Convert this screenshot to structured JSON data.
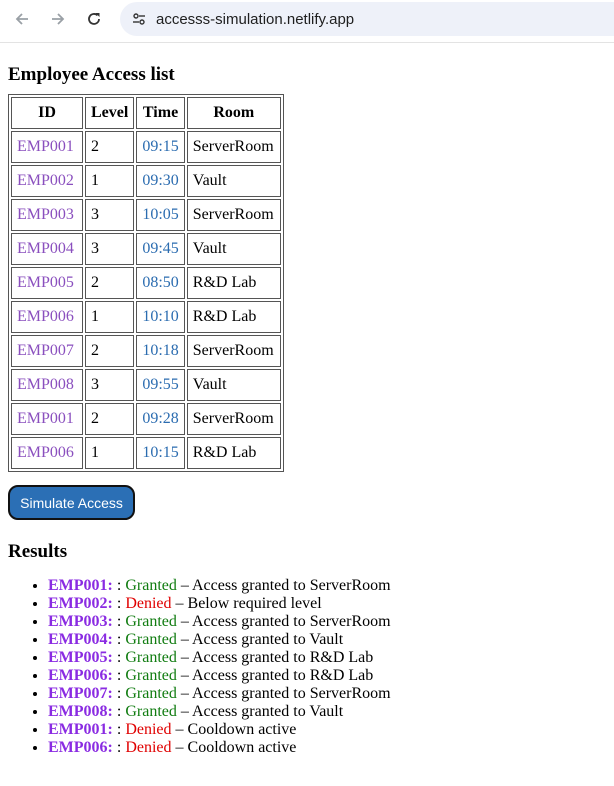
{
  "browser": {
    "url": "accesss-simulation.netlify.app"
  },
  "page": {
    "heading": "Employee Access list",
    "columns": [
      "ID",
      "Level",
      "Time",
      "Room"
    ],
    "rows": [
      {
        "id": "EMP001",
        "level": "2",
        "time": "09:15",
        "room": "ServerRoom"
      },
      {
        "id": "EMP002",
        "level": "1",
        "time": "09:30",
        "room": "Vault"
      },
      {
        "id": "EMP003",
        "level": "3",
        "time": "10:05",
        "room": "ServerRoom"
      },
      {
        "id": "EMP004",
        "level": "3",
        "time": "09:45",
        "room": "Vault"
      },
      {
        "id": "EMP005",
        "level": "2",
        "time": "08:50",
        "room": "R&D Lab"
      },
      {
        "id": "EMP006",
        "level": "1",
        "time": "10:10",
        "room": "R&D Lab"
      },
      {
        "id": "EMP007",
        "level": "2",
        "time": "10:18",
        "room": "ServerRoom"
      },
      {
        "id": "EMP008",
        "level": "3",
        "time": "09:55",
        "room": "Vault"
      },
      {
        "id": "EMP001",
        "level": "2",
        "time": "09:28",
        "room": "ServerRoom"
      },
      {
        "id": "EMP006",
        "level": "1",
        "time": "10:15",
        "room": "R&D Lab"
      }
    ],
    "button_label": "Simulate Access",
    "results_heading": "Results",
    "results": [
      {
        "id": "EMP001:",
        "sep": " : ",
        "status": "Granted",
        "message": " – Access granted to ServerRoom"
      },
      {
        "id": "EMP002:",
        "sep": " : ",
        "status": "Denied",
        "message": " – Below required level"
      },
      {
        "id": "EMP003:",
        "sep": " : ",
        "status": "Granted",
        "message": " – Access granted to ServerRoom"
      },
      {
        "id": "EMP004:",
        "sep": " : ",
        "status": "Granted",
        "message": " – Access granted to Vault"
      },
      {
        "id": "EMP005:",
        "sep": " : ",
        "status": "Granted",
        "message": " – Access granted to R&D Lab"
      },
      {
        "id": "EMP006:",
        "sep": " : ",
        "status": "Granted",
        "message": " – Access granted to R&D Lab"
      },
      {
        "id": "EMP007:",
        "sep": " : ",
        "status": "Granted",
        "message": " – Access granted to ServerRoom"
      },
      {
        "id": "EMP008:",
        "sep": " : ",
        "status": "Granted",
        "message": " – Access granted to Vault"
      },
      {
        "id": "EMP001:",
        "sep": " : ",
        "status": "Denied",
        "message": " – Cooldown active"
      },
      {
        "id": "EMP006:",
        "sep": " : ",
        "status": "Denied",
        "message": " – Cooldown active"
      }
    ]
  },
  "icons": {
    "back": "arrow-left-icon",
    "forward": "arrow-right-icon",
    "reload": "reload-icon",
    "site_info": "tune-icon"
  },
  "colors": {
    "id_link": "#8a4fbe",
    "time": "#2b6cb0",
    "granted": "#107c10",
    "denied": "#e00000",
    "button_bg": "#2b6fb5",
    "result_id": "#8a2be2"
  }
}
